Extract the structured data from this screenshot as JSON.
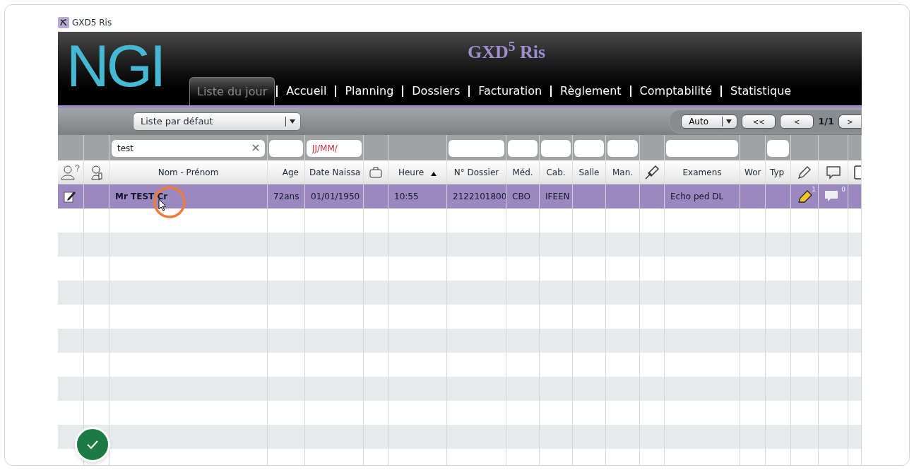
{
  "window": {
    "title": "GXD5 Ris"
  },
  "header": {
    "logo": "NGI",
    "product": "GXD$^{5}$ Ris"
  },
  "tabs": [
    {
      "label": "Liste du jour",
      "selected": true
    },
    {
      "label": "Accueil",
      "selected": false
    },
    {
      "label": "Planning",
      "selected": false
    },
    {
      "label": "Dossiers",
      "selected": false
    },
    {
      "label": "Facturation",
      "selected": false
    },
    {
      "label": "Règlement",
      "selected": false
    },
    {
      "label": "Comptabilité",
      "selected": false
    },
    {
      "label": "Statistique",
      "selected": false
    }
  ],
  "toolbar": {
    "list_select": "Liste par défaut",
    "mode_select": "Auto",
    "first_button": "<<",
    "prev_button": "<",
    "page": "1/1",
    "next_button": ">"
  },
  "columns": [
    {
      "kind": "icon",
      "has_filter": false
    },
    {
      "kind": "icon",
      "has_filter": false
    },
    {
      "kind": "text",
      "label": "Nom - Prénom",
      "has_filter": true,
      "filter_value": "test"
    },
    {
      "kind": "text",
      "label": "Age",
      "has_filter": true
    },
    {
      "kind": "text",
      "label": "Date Naissa",
      "has_filter": true,
      "filter_placeholder": "JJ/MM/"
    },
    {
      "kind": "icon",
      "has_filter": false
    },
    {
      "kind": "text",
      "label": "Heure",
      "sorted": true,
      "has_filter": false
    },
    {
      "kind": "text",
      "label": "N° Dossier",
      "has_filter": true
    },
    {
      "kind": "text",
      "label": "Méd.",
      "has_filter": true
    },
    {
      "kind": "text",
      "label": "Cab.",
      "has_filter": true
    },
    {
      "kind": "text",
      "label": "Salle",
      "has_filter": true
    },
    {
      "kind": "text",
      "label": "Man.",
      "has_filter": true
    },
    {
      "kind": "icon",
      "has_filter": false
    },
    {
      "kind": "text",
      "label": "Examens",
      "has_filter": true
    },
    {
      "kind": "text",
      "label": "Wor",
      "has_filter": false
    },
    {
      "kind": "text",
      "label": "Typ",
      "has_filter": true
    },
    {
      "kind": "icon",
      "has_filter": false
    },
    {
      "kind": "icon",
      "has_filter": false
    },
    {
      "kind": "icon",
      "has_filter": false
    }
  ],
  "rows": [
    {
      "selected": true,
      "cells": [
        {
          "kind": "icon"
        },
        {
          "kind": "empty"
        },
        {
          "kind": "text",
          "text": "Mr TEST Cr",
          "bold": true
        },
        {
          "kind": "text",
          "text": "72ans"
        },
        {
          "kind": "text",
          "text": "01/01/1950"
        },
        {
          "kind": "empty"
        },
        {
          "kind": "text",
          "text": "10:55"
        },
        {
          "kind": "text",
          "text": "2122101800"
        },
        {
          "kind": "text",
          "text": "CBO"
        },
        {
          "kind": "text",
          "text": "IFEEN"
        },
        {
          "kind": "empty"
        },
        {
          "kind": "empty"
        },
        {
          "kind": "empty"
        },
        {
          "kind": "text",
          "text": "Echo ped DL"
        },
        {
          "kind": "empty"
        },
        {
          "kind": "empty"
        },
        {
          "kind": "icon",
          "count": "1"
        },
        {
          "kind": "icon",
          "count": "0"
        },
        {
          "kind": "empty"
        }
      ]
    }
  ]
}
